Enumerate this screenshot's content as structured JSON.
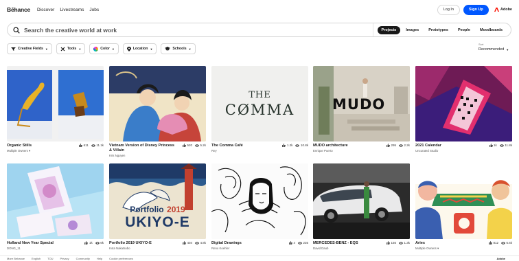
{
  "nav": {
    "logo": "Bēhance",
    "links": [
      "Discover",
      "Livestreams",
      "Jobs"
    ],
    "login": "Log In",
    "signup": "Sign Up",
    "adobe": "Adobe"
  },
  "search": {
    "placeholder": "Search the creative world at work",
    "scopes": [
      "Projects",
      "Images",
      "Prototypes",
      "People",
      "Moodboards"
    ],
    "active_scope": "Projects"
  },
  "filters": [
    {
      "label": "Creative Fields",
      "icon": "creative-fields-icon"
    },
    {
      "label": "Tools",
      "icon": "tools-icon"
    },
    {
      "label": "Color",
      "icon": "color-wheel-icon"
    },
    {
      "label": "Location",
      "icon": "location-pin-icon"
    },
    {
      "label": "Schools",
      "icon": "graduation-cap-icon"
    }
  ],
  "sort": {
    "label": "Sort",
    "value": "Recommended"
  },
  "projects": [
    {
      "title": "Organic Stills",
      "owner": "Multiple Owners",
      "owner_dropdown": true,
      "likes": "611",
      "views": "11.1k"
    },
    {
      "title": "Vietnam Version of Disney Princess & Villain",
      "owner": "Kris Nguyen",
      "owner_dropdown": false,
      "likes": "520",
      "views": "5.2k"
    },
    {
      "title": "The Comma Café",
      "owner": "Rey",
      "owner_dropdown": false,
      "likes": "1.2k",
      "views": "10.8k"
    },
    {
      "title": "MUDO architecture",
      "owner": "Enrique Puerto",
      "owner_dropdown": false,
      "likes": "295",
      "views": "2.2k"
    },
    {
      "title": "2021 Calendar",
      "owner": "Uncurated Studio",
      "owner_dropdown": false,
      "likes": "1k",
      "views": "11.8k"
    },
    {
      "title": "Holland New Year Special",
      "owner": "DONG_11",
      "owner_dropdown": false,
      "likes": "1k",
      "views": "6k"
    },
    {
      "title": "Portfolio 2019 UKIYO-E",
      "owner": "Kota Nakatsubo",
      "owner_dropdown": false,
      "likes": "404",
      "views": "4.8k"
    },
    {
      "title": "Digital Drawings",
      "owner": "Reno Koehler",
      "owner_dropdown": false,
      "likes": "4",
      "views": "235"
    },
    {
      "title": "MERCEDES-BENZ - EQS",
      "owner": "David Daub",
      "owner_dropdown": false,
      "likes": "156",
      "views": "1.3k"
    },
    {
      "title": "Aries",
      "owner": "Multiple Owners",
      "owner_dropdown": true,
      "likes": "812",
      "views": "6.6k"
    }
  ],
  "thumb_text": {
    "comma_line1": "THE",
    "comma_line2": "CØMMA",
    "mudo": "MUDO",
    "ukiyo_line1": "Portfolio",
    "ukiyo_year": "2019",
    "ukiyo_line2": "UKIYO-E"
  },
  "footer": {
    "items": [
      "More Behance",
      "English",
      "TOU",
      "Privacy",
      "Community",
      "Help",
      "Cookie preferences"
    ],
    "adobe": "Adobe"
  },
  "colors": {
    "accent": "#0057ff",
    "active_scope": "#191919"
  }
}
